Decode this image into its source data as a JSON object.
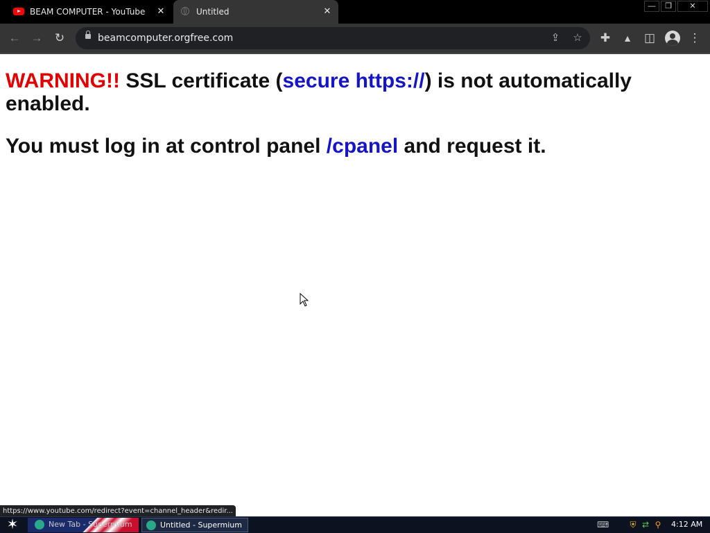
{
  "tabs": [
    {
      "title": "BEAM COMPUTER - YouTube",
      "icon": "youtube-icon"
    },
    {
      "title": "Untitled",
      "icon": "globe-icon",
      "active": true
    }
  ],
  "window_controls": {
    "minimize": "—",
    "restore": "❐",
    "close": "✕"
  },
  "toolbar": {
    "back": "←",
    "forward": "→",
    "reload": "↻",
    "url": "beamcomputer.orgfree.com",
    "share": "⇪",
    "bookmark": "☆",
    "extensions": "✚",
    "labs": "▲",
    "sidepanel": "◫",
    "menu": "⋮"
  },
  "page": {
    "line1_warning": "WARNING!!",
    "line1_a": " SSL certificate (",
    "line1_link": "secure https://",
    "line1_b": ") is not automatically enabled.",
    "line2_a": "You must log in at control panel ",
    "line2_link": "/cpanel",
    "line2_b": " and request it."
  },
  "status_url": "https://www.youtube.com/redirect?event=channel_header&redir...",
  "taskbar": {
    "start": "✶",
    "tasks": [
      {
        "label": "New Tab - Supermium"
      },
      {
        "label": "Untitled - Supermium",
        "active": true
      }
    ],
    "tray": [
      "keyboard-icon",
      "shield-icon",
      "network-icon",
      "search-icon"
    ],
    "clock": "4:12 AM"
  },
  "colors": {
    "warning": "#e00000",
    "link": "#1515c8",
    "tab_active": "#353535"
  }
}
